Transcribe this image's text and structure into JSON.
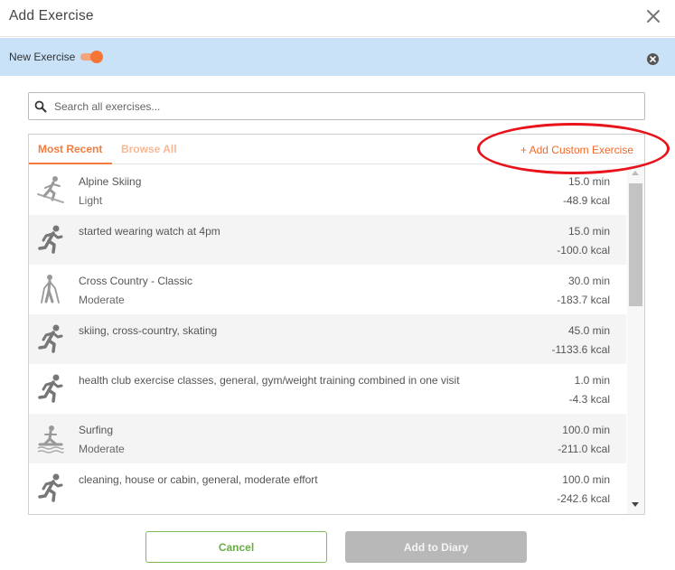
{
  "dialog": {
    "title": "Add Exercise",
    "close_icon": "close-icon"
  },
  "banner": {
    "label": "New Exercise",
    "toggle_on": true,
    "accent": "#f47535",
    "background": "#c9e2f8"
  },
  "search": {
    "placeholder": "Search all exercises...",
    "value": ""
  },
  "tabs": {
    "most_recent": "Most Recent",
    "browse_all": "Browse All",
    "add_custom": "+ Add Custom Exercise"
  },
  "exercises": [
    {
      "name": "Alpine Skiing",
      "intensity": "Light",
      "duration": "15.0 min",
      "calories": "-48.9 kcal",
      "icon": "skiing-icon"
    },
    {
      "name": "started wearing watch at 4pm",
      "intensity": "",
      "duration": "15.0 min",
      "calories": "-100.0 kcal",
      "icon": "running-icon"
    },
    {
      "name": "Cross Country - Classic",
      "intensity": "Moderate",
      "duration": "30.0 min",
      "calories": "-183.7 kcal",
      "icon": "cross-country-icon"
    },
    {
      "name": "skiing, cross-country, skating",
      "intensity": "",
      "duration": "45.0 min",
      "calories": "-1133.6 kcal",
      "icon": "running-icon"
    },
    {
      "name": "health club exercise classes, general, gym/weight training combined in one visit",
      "intensity": "",
      "duration": "1.0 min",
      "calories": "-4.3 kcal",
      "icon": "running-icon"
    },
    {
      "name": "Surfing",
      "intensity": "Moderate",
      "duration": "100.0 min",
      "calories": "-211.0 kcal",
      "icon": "surfing-icon"
    },
    {
      "name": "cleaning, house or cabin, general, moderate effort",
      "intensity": "",
      "duration": "100.0 min",
      "calories": "-242.6 kcal",
      "icon": "running-icon"
    }
  ],
  "buttons": {
    "cancel": "Cancel",
    "add_to_diary": "Add to Diary"
  }
}
